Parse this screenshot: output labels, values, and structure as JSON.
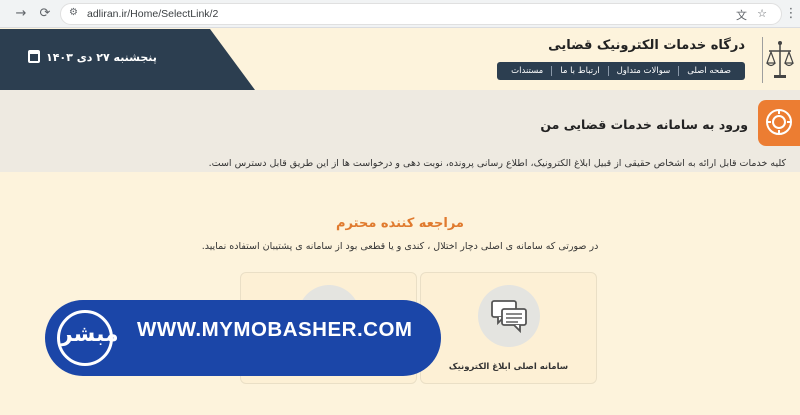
{
  "browser": {
    "url": "adliran.ir/Home/SelectLink/2"
  },
  "header": {
    "date": "پنجشنبه ۲۷ دی ۱۴۰۳",
    "site_title": "درگاه خدمات الکترونیک قضایی",
    "menu": [
      "صفحه اصلی",
      "سوالات متداول",
      "ارتباط با ما",
      "مستندات"
    ]
  },
  "intro": {
    "title": "ورود به سامانه خدمات قضایی من",
    "description": "کلیه خدمات قابل ارائه به اشخاص حقیقی از قبیل ابلاغ الکترونیک، اطلاع رسانی پرونده، نوبت دهی و درخواست ها از این طریق قابل دسترس است."
  },
  "main": {
    "title": "مراجعه کننده محترم",
    "subtitle": "در صورتی که سامانه ی اصلی دچار اختلال ، کندی و یا قطعی بود از سامانه ی پشتیبان استفاده نمایید.",
    "cards": [
      {
        "label": "سامانه اصلی ابلاغ الکترونیک",
        "icon": "chat-bubbles-icon"
      },
      {
        "label": "",
        "icon": "chat-bubbles-icon"
      }
    ]
  },
  "watermark": {
    "text": "WWW.MYMOBASHER.COM",
    "logo_text": "مبشر"
  },
  "colors": {
    "accent_orange": "#ec7d32",
    "dark_navy": "#2c3e50",
    "page_bg": "#fdf3dc",
    "watermark_blue": "#1b46a8"
  }
}
